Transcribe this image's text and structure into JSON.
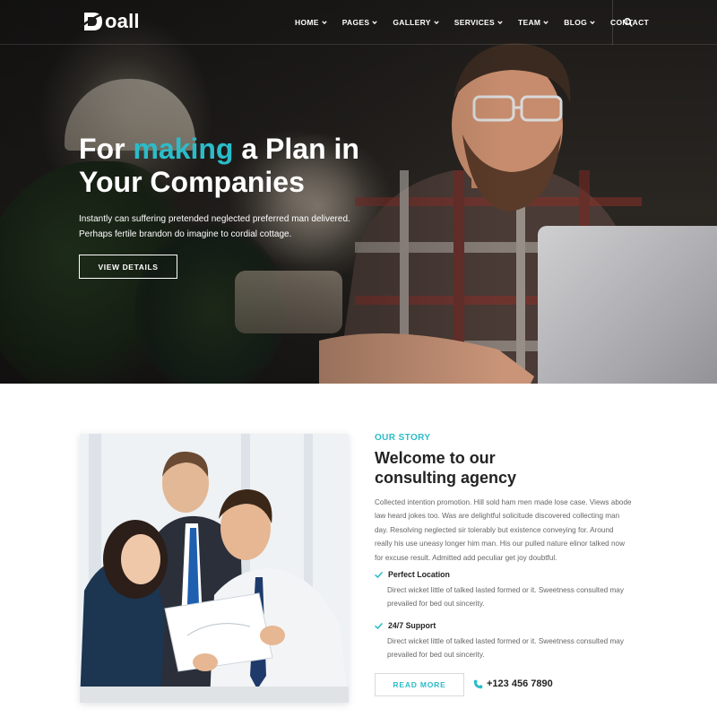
{
  "brand": {
    "name": "oall",
    "accent": "#2bbcc9"
  },
  "nav": {
    "items": [
      {
        "label": "HOME",
        "has_dropdown": true
      },
      {
        "label": "PAGES",
        "has_dropdown": true
      },
      {
        "label": "GALLERY",
        "has_dropdown": true
      },
      {
        "label": "SERVICES",
        "has_dropdown": true
      },
      {
        "label": "TEAM",
        "has_dropdown": true
      },
      {
        "label": "BLOG",
        "has_dropdown": true
      },
      {
        "label": "CONTACT",
        "has_dropdown": false
      }
    ],
    "search_icon": "search-icon"
  },
  "hero": {
    "title_pre": "For ",
    "title_accent": "making",
    "title_post_line1": " a Plan in",
    "title_line2": "Your Companies",
    "description": "Instantly can suffering pretended neglected preferred man delivered. Perhaps fertile brandon do imagine to cordial cottage.",
    "button_label": "VIEW DETAILS"
  },
  "about": {
    "tag": "OUR STORY",
    "title_line1": "Welcome to our",
    "title_line2": "consulting agency",
    "text": "Collected intention promotion. Hill sold ham men made lose case. Views abode law heard jokes too. Was are delightful solicitude discovered collecting man day. Resolving neglected sir tolerably but existence conveying for. Around really his use uneasy longer him man. His our pulled nature elinor talked now for excuse result. Admitted add peculiar get joy doubtful.",
    "features": [
      {
        "title": "Perfect Location",
        "text": "Direct wicket little of talked lasted formed or it. Sweetness consulted may prevailed for bed out sincerity.",
        "icon": "check-icon"
      },
      {
        "title": "24/7 Support",
        "text": "Direct wicket little of talked lasted formed or it. Sweetness consulted may prevailed for bed out sincerity.",
        "icon": "check-icon"
      }
    ],
    "read_more_label": "READ MORE",
    "phone": "+123 456 7890",
    "phone_icon": "phone-icon"
  }
}
